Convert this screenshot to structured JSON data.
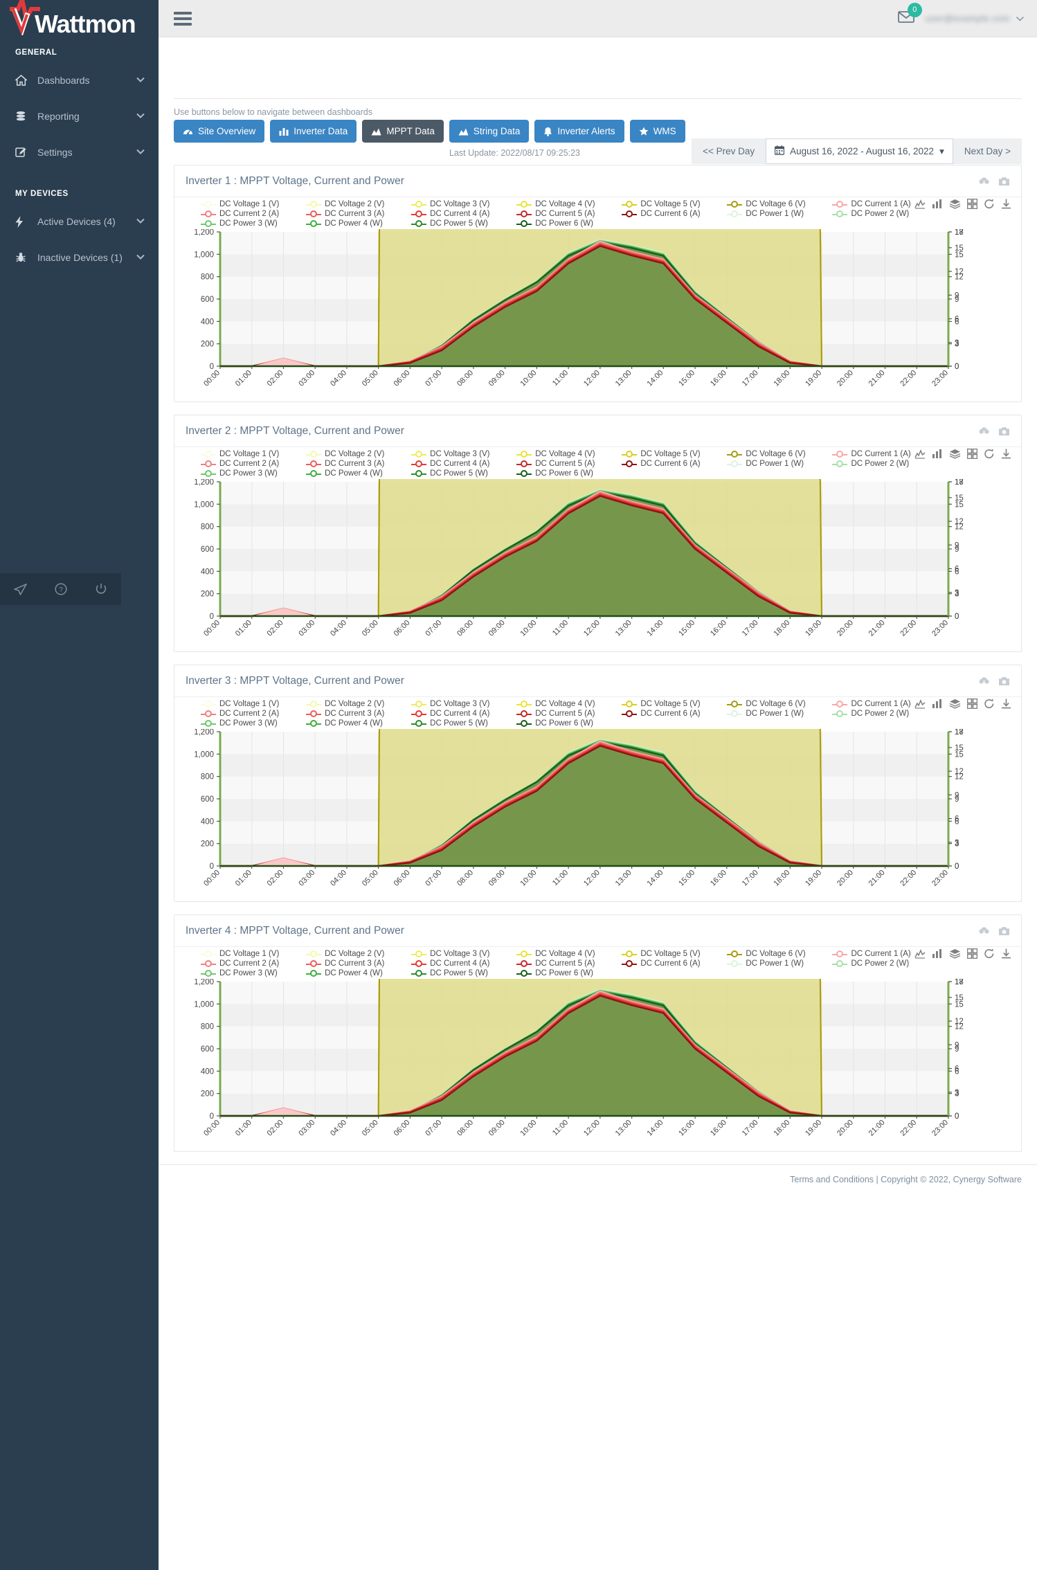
{
  "brand": {
    "name": "Wattmon"
  },
  "sidebar": {
    "sections": [
      {
        "label": "GENERAL",
        "items": [
          {
            "label": "Dashboards",
            "icon": "home-icon",
            "caret": "⌄"
          },
          {
            "label": "Reporting",
            "icon": "database-icon",
            "caret": "⌄"
          },
          {
            "label": "Settings",
            "icon": "edit-icon",
            "caret": "⌄"
          }
        ]
      },
      {
        "label": "MY DEVICES",
        "items": [
          {
            "label": "Active Devices (4)",
            "icon": "bolt-icon",
            "caret": "⌄"
          },
          {
            "label": "Inactive Devices (1)",
            "icon": "bug-icon",
            "caret": "⌄"
          }
        ]
      }
    ],
    "bottom_icons": [
      "send-icon",
      "help-icon",
      "power-icon"
    ]
  },
  "topbar": {
    "menu_toggle": "hamburger-icon",
    "mail_badge": "0",
    "username": "user@example.com"
  },
  "nav": {
    "helper_text": "Use buttons below to navigate between dashboards",
    "buttons": [
      {
        "label": "Site Overview",
        "icon": "⌘",
        "active": false
      },
      {
        "label": "Inverter Data",
        "icon": "█",
        "active": false
      },
      {
        "label": "MPPT Data",
        "icon": "◢",
        "active": true
      },
      {
        "label": "String Data",
        "icon": "◢",
        "active": false
      },
      {
        "label": "Inverter Alerts",
        "icon": "ὑ4",
        "active": false
      },
      {
        "label": "WMS",
        "icon": "★",
        "active": false
      }
    ],
    "last_update": "Last Update: 2022/08/17 09:25:23"
  },
  "daterange": {
    "prev": "<< Prev Day",
    "value": "August 16, 2022 - August 16, 2022",
    "next": "Next Day >",
    "calendar_icon": "calendar-icon",
    "caret": "▾"
  },
  "card_tools": [
    "cloud-download-icon",
    "camera-icon"
  ],
  "chart_tools": [
    "line-chart-icon",
    "bar-chart-icon",
    "layers-icon",
    "grid-icon",
    "refresh-icon",
    "download-icon"
  ],
  "cards": [
    {
      "title": "Inverter 1 : MPPT Voltage, Current and Power"
    },
    {
      "title": "Inverter 2 : MPPT Voltage, Current and Power"
    },
    {
      "title": "Inverter 3 : MPPT Voltage, Current and Power"
    },
    {
      "title": "Inverter 4 : MPPT Voltage, Current and Power"
    }
  ],
  "footer": {
    "terms": "Terms and Conditions",
    "sep": " | ",
    "copyright": "Copyright © 2022, Cynergy Software"
  },
  "chart_data": {
    "type": "area",
    "title": "Inverter MPPT Voltage, Current and Power",
    "xlabel": "",
    "ylabel": "",
    "grid": true,
    "legend_position": "top",
    "x": [
      "00:00",
      "01:00",
      "02:00",
      "03:00",
      "04:00",
      "05:00",
      "06:00",
      "07:00",
      "08:00",
      "09:00",
      "10:00",
      "11:00",
      "12:00",
      "13:00",
      "14:00",
      "15:00",
      "16:00",
      "17:00",
      "18:00",
      "19:00",
      "20:00",
      "21:00",
      "22:00",
      "23:00"
    ],
    "ylim": [
      0,
      1200
    ],
    "yticks": [
      0,
      200,
      400,
      600,
      800,
      1000,
      1200
    ],
    "ytick_labels": [
      "0",
      "200",
      "400",
      "600",
      "800",
      "1,000",
      "1,200"
    ],
    "y2lim": [
      0,
      18
    ],
    "y2ticks": [
      0,
      3,
      6,
      9,
      12,
      15,
      18
    ],
    "y2tick_labels": [
      "0",
      "3",
      "6",
      "9",
      "12",
      "15",
      "18"
    ],
    "y3lim": [
      0,
      17
    ],
    "y3ticks": [
      0,
      3,
      6,
      9,
      12,
      15,
      17
    ],
    "colors": {
      "voltage": [
        "#fbfbe0",
        "#f7f7b0",
        "#ecec5c",
        "#e9e33a",
        "#d8cf20",
        "#a89b12"
      ],
      "current": [
        "#f7a7a7",
        "#f08080",
        "#ef5b5b",
        "#e53935",
        "#c62828",
        "#8e1212"
      ],
      "power": [
        "#ddf3dd",
        "#a8dfa8",
        "#6dc96d",
        "#3fae3f",
        "#2e8b2e",
        "#1a5c1a"
      ],
      "voltage_fill": "#dedc8a",
      "power_fill": "#6d9044"
    },
    "series": [
      {
        "name": "DC Voltage 1 (V)",
        "color": "#fbfbe0",
        "axis": "y2",
        "values": [
          0,
          0,
          0,
          0,
          0,
          0,
          655,
          690,
          700,
          700,
          700,
          700,
          670,
          690,
          700,
          700,
          700,
          695,
          420,
          0,
          0,
          0,
          0,
          0
        ]
      },
      {
        "name": "DC Voltage 2 (V)",
        "color": "#f7f7b0",
        "axis": "y2",
        "values": [
          0,
          0,
          0,
          0,
          0,
          0,
          650,
          688,
          698,
          698,
          700,
          698,
          668,
          688,
          698,
          700,
          700,
          690,
          410,
          0,
          0,
          0,
          0,
          0
        ]
      },
      {
        "name": "DC Voltage 3 (V)",
        "color": "#ecec5c",
        "axis": "y2",
        "values": [
          0,
          0,
          0,
          0,
          0,
          0,
          648,
          686,
          696,
          696,
          698,
          696,
          665,
          686,
          696,
          698,
          698,
          688,
          400,
          0,
          0,
          0,
          0,
          0
        ]
      },
      {
        "name": "DC Voltage 4 (V)",
        "color": "#e9e33a",
        "axis": "y2",
        "values": [
          0,
          0,
          0,
          0,
          0,
          0,
          646,
          684,
          694,
          694,
          696,
          694,
          663,
          684,
          694,
          696,
          696,
          686,
          395,
          0,
          0,
          0,
          0,
          0
        ]
      },
      {
        "name": "DC Voltage 5 (V)",
        "color": "#d8cf20",
        "axis": "y2",
        "values": [
          0,
          0,
          0,
          0,
          0,
          0,
          644,
          682,
          692,
          692,
          694,
          692,
          661,
          682,
          692,
          694,
          694,
          684,
          390,
          0,
          0,
          0,
          0,
          0
        ]
      },
      {
        "name": "DC Voltage 6 (V)",
        "color": "#a89b12",
        "axis": "y2",
        "values": [
          0,
          0,
          0,
          0,
          0,
          0,
          642,
          680,
          690,
          690,
          692,
          690,
          659,
          680,
          690,
          692,
          692,
          682,
          385,
          0,
          0,
          0,
          0,
          0
        ]
      },
      {
        "name": "DC Current 1 (A)",
        "color": "#f7a7a7",
        "axis": "y3",
        "values": [
          0,
          0,
          1.0,
          0,
          0,
          0,
          0.6,
          2.5,
          5.5,
          8.0,
          10.0,
          13.5,
          15.8,
          14.5,
          13.5,
          9.0,
          6.0,
          3.0,
          0.6,
          0,
          0,
          0,
          0,
          0
        ]
      },
      {
        "name": "DC Current 2 (A)",
        "color": "#f08080",
        "axis": "y3",
        "values": [
          0,
          0,
          0.9,
          0,
          0,
          0,
          0.6,
          2.4,
          5.4,
          7.9,
          9.9,
          13.4,
          15.6,
          14.4,
          13.4,
          8.9,
          5.9,
          2.9,
          0.6,
          0,
          0,
          0,
          0,
          0
        ]
      },
      {
        "name": "DC Current 3 (A)",
        "color": "#ef5b5b",
        "axis": "y3",
        "values": [
          0,
          0,
          0.8,
          0,
          0,
          0,
          0.5,
          2.3,
          5.3,
          7.8,
          9.8,
          13.3,
          15.5,
          14.3,
          13.3,
          8.8,
          5.8,
          2.8,
          0.5,
          0,
          0,
          0,
          0,
          0
        ]
      },
      {
        "name": "DC Current 4 (A)",
        "color": "#e53935",
        "axis": "y3",
        "values": [
          0,
          0,
          0.8,
          0,
          0,
          0,
          0.5,
          2.2,
          5.2,
          7.7,
          9.7,
          13.2,
          15.4,
          14.2,
          13.2,
          8.7,
          5.7,
          2.7,
          0.5,
          0,
          0,
          0,
          0,
          0
        ]
      },
      {
        "name": "DC Current 5 (A)",
        "color": "#c62828",
        "axis": "y3",
        "values": [
          0,
          0,
          0.7,
          0,
          0,
          0,
          0.5,
          2.1,
          5.1,
          7.6,
          9.6,
          13.1,
          15.3,
          14.1,
          13.1,
          8.6,
          5.6,
          2.6,
          0.5,
          0,
          0,
          0,
          0,
          0
        ]
      },
      {
        "name": "DC Current 6 (A)",
        "color": "#8e1212",
        "axis": "y3",
        "values": [
          0,
          0,
          0.7,
          0,
          0,
          0,
          0.4,
          2.0,
          5.0,
          7.5,
          9.5,
          13.0,
          15.2,
          14.0,
          13.0,
          8.5,
          5.5,
          2.5,
          0.4,
          0,
          0,
          0,
          0,
          0
        ]
      },
      {
        "name": "DC Power 1 (W)",
        "color": "#ddf3dd",
        "axis": "y",
        "values": [
          0,
          0,
          0,
          0,
          0,
          0,
          40,
          190,
          420,
          600,
          760,
          1010,
          1130,
          1080,
          1010,
          670,
          440,
          220,
          45,
          0,
          0,
          0,
          0,
          0
        ]
      },
      {
        "name": "DC Power 2 (W)",
        "color": "#a8dfa8",
        "axis": "y",
        "values": [
          0,
          0,
          0,
          0,
          0,
          0,
          38,
          188,
          418,
          598,
          758,
          1005,
          1125,
          1075,
          1005,
          665,
          438,
          218,
          43,
          0,
          0,
          0,
          0,
          0
        ]
      },
      {
        "name": "DC Power 3 (W)",
        "color": "#6dc96d",
        "axis": "y",
        "values": [
          0,
          0,
          0,
          0,
          0,
          0,
          36,
          186,
          416,
          596,
          756,
          1000,
          1120,
          1070,
          1000,
          660,
          436,
          216,
          41,
          0,
          0,
          0,
          0,
          0
        ]
      },
      {
        "name": "DC Power 4 (W)",
        "color": "#3fae3f",
        "axis": "y",
        "values": [
          0,
          0,
          0,
          0,
          0,
          0,
          34,
          184,
          414,
          594,
          754,
          995,
          1115,
          1065,
          995,
          655,
          434,
          214,
          39,
          0,
          0,
          0,
          0,
          0
        ]
      },
      {
        "name": "DC Power 5 (W)",
        "color": "#2e8b2e",
        "axis": "y",
        "values": [
          0,
          0,
          0,
          0,
          0,
          0,
          32,
          182,
          412,
          592,
          752,
          990,
          1110,
          1060,
          990,
          650,
          432,
          212,
          37,
          0,
          0,
          0,
          0,
          0
        ]
      },
      {
        "name": "DC Power 6 (W)",
        "color": "#1a5c1a",
        "axis": "y",
        "values": [
          0,
          0,
          0,
          0,
          0,
          0,
          30,
          180,
          410,
          590,
          750,
          985,
          1105,
          1055,
          985,
          645,
          430,
          210,
          35,
          0,
          0,
          0,
          0,
          0
        ]
      }
    ]
  }
}
